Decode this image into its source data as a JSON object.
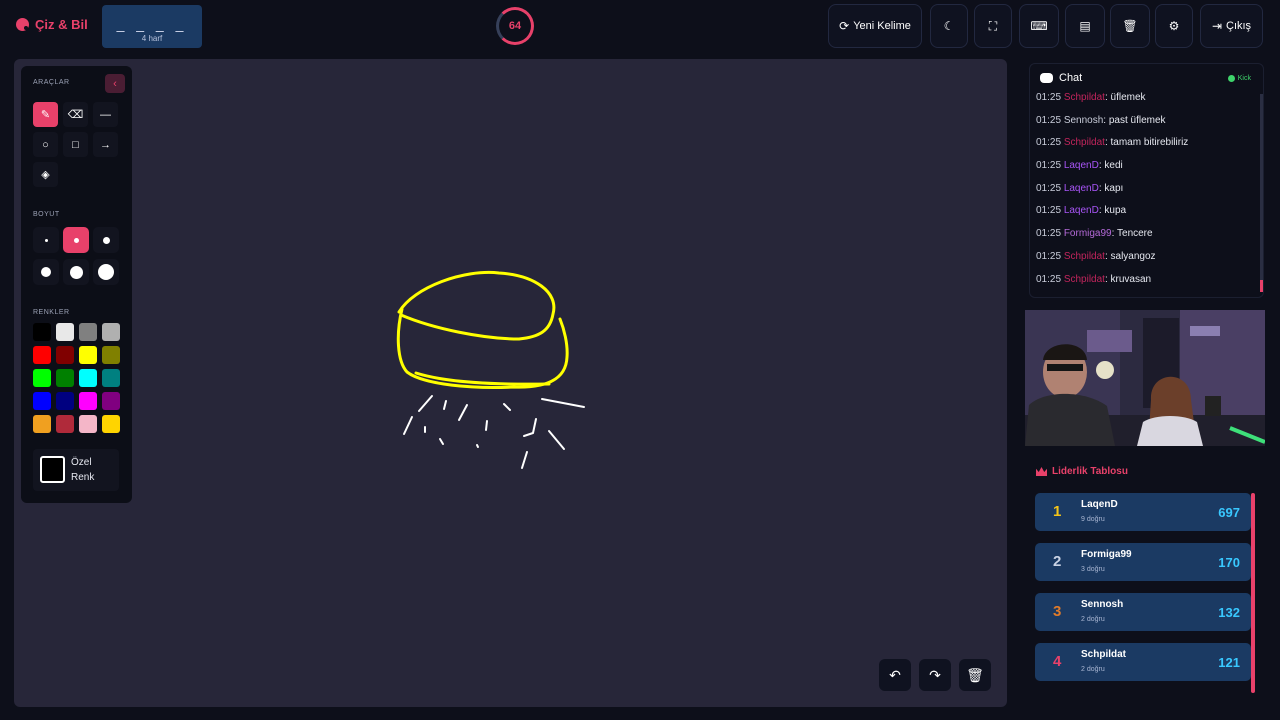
{
  "app": {
    "title": "Çiz & Bil"
  },
  "word": {
    "dashes": "_ _ _ _",
    "hint": "4 harf"
  },
  "timer": {
    "value": "64"
  },
  "toolbar": {
    "new_word": "Yeni Kelime",
    "exit": "Çıkış",
    "icons": [
      "refresh-icon",
      "moon-icon",
      "fullscreen-icon",
      "keyboard-icon",
      "archive-icon",
      "trash-icon",
      "gear-icon",
      "sign-out-icon"
    ]
  },
  "tools_panel": {
    "section_tools": "ARAÇLAR",
    "section_size": "BOYUT",
    "section_colors": "RENKLER",
    "custom_color": "Özel Renk",
    "colors": [
      "#000000",
      "#e8e8e8",
      "#808080",
      "#b0b0b0",
      "#ff0000",
      "#800000",
      "#ffff00",
      "#808000",
      "#00ff00",
      "#008000",
      "#00ffff",
      "#008080",
      "#0000ff",
      "#000080",
      "#ff00ff",
      "#800080",
      "#f0a020",
      "#b02a3a",
      "#f4b6c8",
      "#ffd400"
    ]
  },
  "chat": {
    "title": "Chat",
    "source": "Kick",
    "messages": [
      {
        "time": "01:25",
        "user": "Schpildat",
        "text": ": üflemek",
        "color": "#c2255c"
      },
      {
        "time": "01:25",
        "user": "Sennosh",
        "text": ": past üflemek",
        "color": "#c9cdda"
      },
      {
        "time": "01:25",
        "user": "Schpildat",
        "text": ": tamam bitirebiliriz",
        "color": "#c2255c"
      },
      {
        "time": "01:25",
        "user": "LaqenD",
        "text": ": kedi",
        "color": "#a855f7"
      },
      {
        "time": "01:25",
        "user": "LaqenD",
        "text": ": kapı",
        "color": "#a855f7"
      },
      {
        "time": "01:25",
        "user": "LaqenD",
        "text": ": kupa",
        "color": "#a855f7"
      },
      {
        "time": "01:25",
        "user": "Formiga99",
        "text": ": Tencere",
        "color": "#b46ad8"
      },
      {
        "time": "01:25",
        "user": "Schpildat",
        "text": ": salyangoz",
        "color": "#c2255c"
      },
      {
        "time": "01:25",
        "user": "Schpildat",
        "text": ": kruvasan",
        "color": "#c2255c"
      }
    ]
  },
  "leaderboard": {
    "title": "Liderlik Tablosu",
    "rows": [
      {
        "rank": "1",
        "name": "LaqenD",
        "sub": "9 doğru",
        "score": "697",
        "rank_color": "#f5c518"
      },
      {
        "rank": "2",
        "name": "Formiga99",
        "sub": "3 doğru",
        "score": "170",
        "rank_color": "#c9d2e4"
      },
      {
        "rank": "3",
        "name": "Sennosh",
        "sub": "2 doğru",
        "score": "132",
        "rank_color": "#e07b2a"
      },
      {
        "rank": "4",
        "name": "Schpildat",
        "sub": "2 doğru",
        "score": "121",
        "rank_color": "#e8416a"
      }
    ]
  }
}
